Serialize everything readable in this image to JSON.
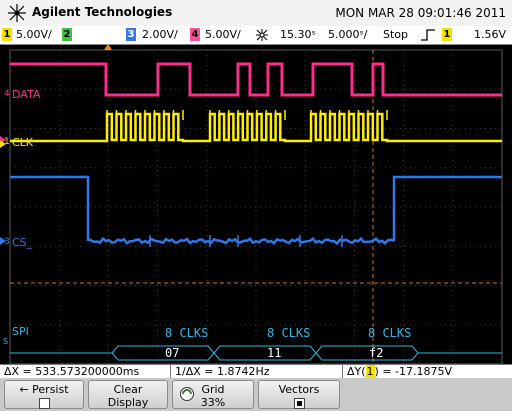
{
  "header": {
    "brand": "Agilent Technologies",
    "datetime": "MON MAR 28 09:01:46 2011"
  },
  "settings": {
    "ch1": {
      "number": "1",
      "scale": "5.00V/",
      "color": "#f5e000"
    },
    "ch2": {
      "number": "2",
      "color": "#41c43d"
    },
    "ch3": {
      "number": "3",
      "scale": "2.00V/",
      "color": "#3b78e7"
    },
    "ch4": {
      "number": "4",
      "scale": "5.00V/",
      "color": "#ff4f9a"
    },
    "trigger_icon": "sunburst-icon",
    "timebase_position": "15.30ˢ",
    "timebase_scale": "5.000ˢ/",
    "run_state": "Stop",
    "trigger_edge_icon": "rising-edge-icon",
    "trigger_source": "1",
    "trigger_level": "1.56V"
  },
  "waveforms": {
    "data_label": "DATA",
    "clk_label": "CLK",
    "cs_label": "CS_",
    "spi_label": "SPI",
    "spi_sub": "S",
    "colors": {
      "data": "#ff2d8a",
      "clk": "#ffee00",
      "cs": "#2f78e8",
      "bus": "#2fb8e4",
      "cursor": "#e08a20"
    }
  },
  "decode": {
    "frames": [
      {
        "clks": "8 CLKS",
        "value": "07"
      },
      {
        "clks": "8 CLKS",
        "value": "11"
      },
      {
        "clks": "8 CLKS",
        "value": "f2"
      }
    ]
  },
  "measurements": {
    "delta_x": "ΔX = 533.573200000ms",
    "inv_delta_x": "1/ΔX = 1.8742Hz",
    "delta_y_prefix": "ΔY(",
    "delta_y_channel": "1",
    "delta_y_suffix": ") = -17.1875V"
  },
  "softkeys": {
    "persist": {
      "label": "Persist",
      "arrow": "←"
    },
    "clear": {
      "line1": "Clear",
      "line2": "Display"
    },
    "grid": {
      "line1": "Grid",
      "line2": "33%",
      "icon": "knob-icon"
    },
    "vectors": {
      "line1": "Vectors"
    }
  }
}
